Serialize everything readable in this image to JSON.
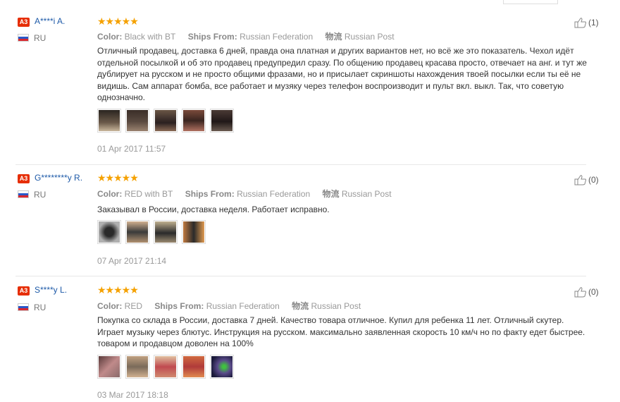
{
  "reviews": [
    {
      "badge": "A3",
      "name": "A****i A.",
      "country": "RU",
      "color_label": "Color:",
      "color_value": "Black with BT",
      "ships_label": "Ships From:",
      "ships_value": "Russian Federation",
      "logistics_label": "物流",
      "logistics_value": "Russian Post",
      "text": "Отличный продавец, доставка 6 дней, правда она платная и других вариантов нет, но всё же это показатель. Чехол идёт отдельной посылкой и об это продавец предупредил сразу. По общению продавец красава просто, отвечает на анг. и тут же дублирует на русском и не просто общими фразами, но и присылает скриншоты нахождения твоей посылки если ты её не видишь. Сам аппарат бомба, все работает и музяку через телефон воспроизводит и пульт вкл. выкл. Так, что советую однозначно.",
      "photos": [
        "#6b5a4a",
        "#5a4a40",
        "#6a5545",
        "#7a4a3a",
        "#4a3a35"
      ],
      "date": "01 Apr 2017 11:57",
      "likes": "(1)"
    },
    {
      "badge": "A3",
      "name": "G********y R.",
      "country": "RU",
      "color_label": "Color:",
      "color_value": "RED with BT",
      "ships_label": "Ships From:",
      "ships_value": "Russian Federation",
      "logistics_label": "物流",
      "logistics_value": "Russian Post",
      "text": "Заказывал в России, доставка неделя. Работает исправно.",
      "photos": [
        "#8a8a8a",
        "#b09070",
        "#9a8a70",
        "#c07a40"
      ],
      "date": "07 Apr 2017 21:14",
      "likes": "(0)"
    },
    {
      "badge": "A3",
      "name": "S****y L.",
      "country": "RU",
      "color_label": "Color:",
      "color_value": "RED",
      "ships_label": "Ships From:",
      "ships_value": "Russian Federation",
      "logistics_label": "物流",
      "logistics_value": "Russian Post",
      "text": "Покупка со склада в России, доставка 7 дней. Качество товара отличное. Купил для ребенка 11 лет. Отличный скутер. Играет музыку через блютус. Инструкция на русском. максимально заявленная скорость 10 км/ч но по факту едет быстрее. товаром и продавцом доволен на 100%",
      "photos": [
        "#8a6a6a",
        "#a08a70",
        "#c04a50",
        "#b03a3a",
        "#5a4a8a"
      ],
      "date": "03 Mar 2017 18:18",
      "likes": "(0)"
    }
  ],
  "colors": {
    "name": "#1e5aa8",
    "star": "#f5a100",
    "badge": "#e62e04"
  }
}
